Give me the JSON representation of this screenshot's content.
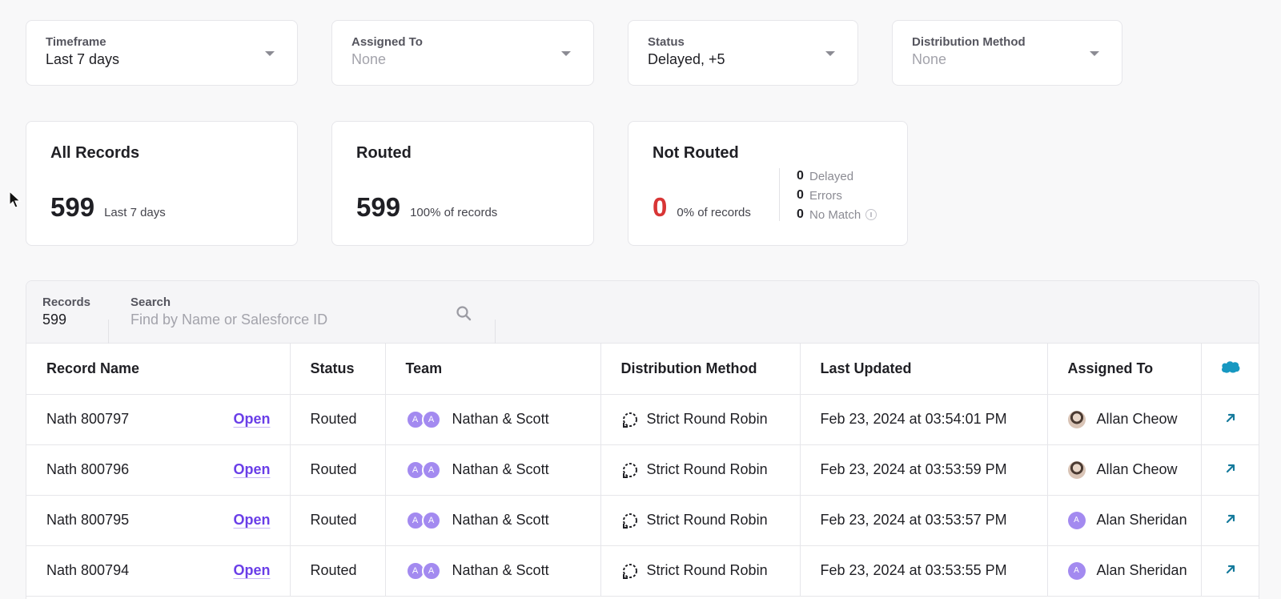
{
  "filters": [
    {
      "label": "Timeframe",
      "value": "Last 7 days",
      "placeholder": false
    },
    {
      "label": "Assigned To",
      "value": "None",
      "placeholder": true
    },
    {
      "label": "Status",
      "value": "Delayed, +5",
      "placeholder": false
    },
    {
      "label": "Distribution Method",
      "value": "None",
      "placeholder": true
    }
  ],
  "cards": {
    "all": {
      "title": "All Records",
      "value": "599",
      "sub": "Last 7 days"
    },
    "routed": {
      "title": "Routed",
      "value": "599",
      "sub": "100% of records"
    },
    "not_routed": {
      "title": "Not Routed",
      "value": "0",
      "sub": "0% of records",
      "breakdown": [
        {
          "count": "0",
          "label": "Delayed"
        },
        {
          "count": "0",
          "label": "Errors"
        },
        {
          "count": "0",
          "label": "No Match"
        }
      ]
    }
  },
  "toolbar": {
    "records_label": "Records",
    "records_value": "599",
    "search_label": "Search",
    "search_placeholder": "Find by Name or Salesforce ID"
  },
  "table": {
    "columns": [
      "Record Name",
      "Status",
      "Team",
      "Distribution Method",
      "Last Updated",
      "Assigned To"
    ],
    "open_label": "Open",
    "rows": [
      {
        "name": "Nath 800797",
        "status": "Routed",
        "team_initials": [
          "A",
          "A"
        ],
        "team": "Nathan & Scott",
        "method": "Strict Round Robin",
        "updated": "Feb 23, 2024 at 03:54:01 PM",
        "assignee": "Allan Cheow",
        "assignee_initial": ""
      },
      {
        "name": "Nath 800796",
        "status": "Routed",
        "team_initials": [
          "A",
          "A"
        ],
        "team": "Nathan & Scott",
        "method": "Strict Round Robin",
        "updated": "Feb 23, 2024 at 03:53:59 PM",
        "assignee": "Allan Cheow",
        "assignee_initial": ""
      },
      {
        "name": "Nath 800795",
        "status": "Routed",
        "team_initials": [
          "A",
          "A"
        ],
        "team": "Nathan & Scott",
        "method": "Strict Round Robin",
        "updated": "Feb 23, 2024 at 03:53:57 PM",
        "assignee": "Alan Sheridan",
        "assignee_initial": "A"
      },
      {
        "name": "Nath 800794",
        "status": "Routed",
        "team_initials": [
          "A",
          "A"
        ],
        "team": "Nathan & Scott",
        "method": "Strict Round Robin",
        "updated": "Feb 23, 2024 at 03:53:55 PM",
        "assignee": "Alan Sheridan",
        "assignee_initial": "A"
      }
    ]
  },
  "colors": {
    "accent": "#6a3ee8",
    "error": "#d83535",
    "salesforce": "#1798c1",
    "link_arrow": "#157a9c"
  },
  "icons": [
    "chevron-down-icon",
    "search-icon",
    "info-icon",
    "salesforce-cloud-icon",
    "round-robin-icon",
    "external-link-icon",
    "cursor-icon"
  ]
}
